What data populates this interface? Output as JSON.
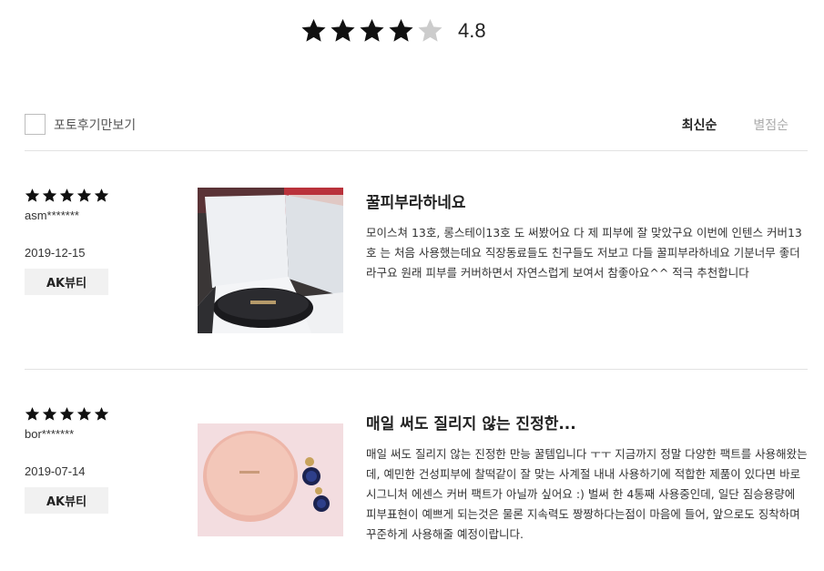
{
  "summary": {
    "rating": 4.8,
    "score_text": "4.8",
    "stars_filled": 4,
    "stars_total": 5
  },
  "filter": {
    "photo_only_label": "포토후기만보기",
    "sort": {
      "latest": "최신순",
      "rating": "별점순",
      "active": "latest"
    }
  },
  "reviews": [
    {
      "stars": 5,
      "user": "asm*******",
      "date": "2019-12-15",
      "brand": "AK뷰티",
      "title": "꿀피부라하네요",
      "body": "모이스쳐 13호, 롱스테이13호 도 써봤어요 다 제 피부에 잘 맞았구요 이번에 인텐스 커버13호 는 처음 사용했는데요 직장동료들도 친구들도 저보고 다들 꿀피부라하네요 기분너무 좋더라구요 원래 피부를 커버하면서 자연스럽게 보여서 참좋아요^^ 적극 추천합니다",
      "photo": "open-product-box-photo"
    },
    {
      "stars": 5,
      "user": "bor*******",
      "date": "2019-07-14",
      "brand": "AK뷰티",
      "title": "매일 써도 질리지 않는 진정한...",
      "body": "매일 써도 질리지 않는 진정한 만능 꿀템입니다 ㅜㅜ 지금까지 정말 다양한 팩트를 사용해왔는데, 예민한 건성피부에 찰떡같이 잘 맞는 사계절 내내 사용하기에 적합한 제품이 있다면 바로 시그니처 에센스 커버 팩트가 아닐까 싶어요 :) 벌써 한 4통째 사용중인데, 일단 짐승용량에 피부표현이 예쁘게 되는것은 물론 지속력도 짱짱하다는점이 마음에 들어, 앞으로도 징착하며 꾸준하게 사용해줄 예정이랍니다.",
      "photo": "pink-compact-photo"
    }
  ],
  "colors": {
    "star": "#111111",
    "star_empty": "#cccccc",
    "badge_bg": "#f1f1f1",
    "divider": "#e2e2e2"
  }
}
